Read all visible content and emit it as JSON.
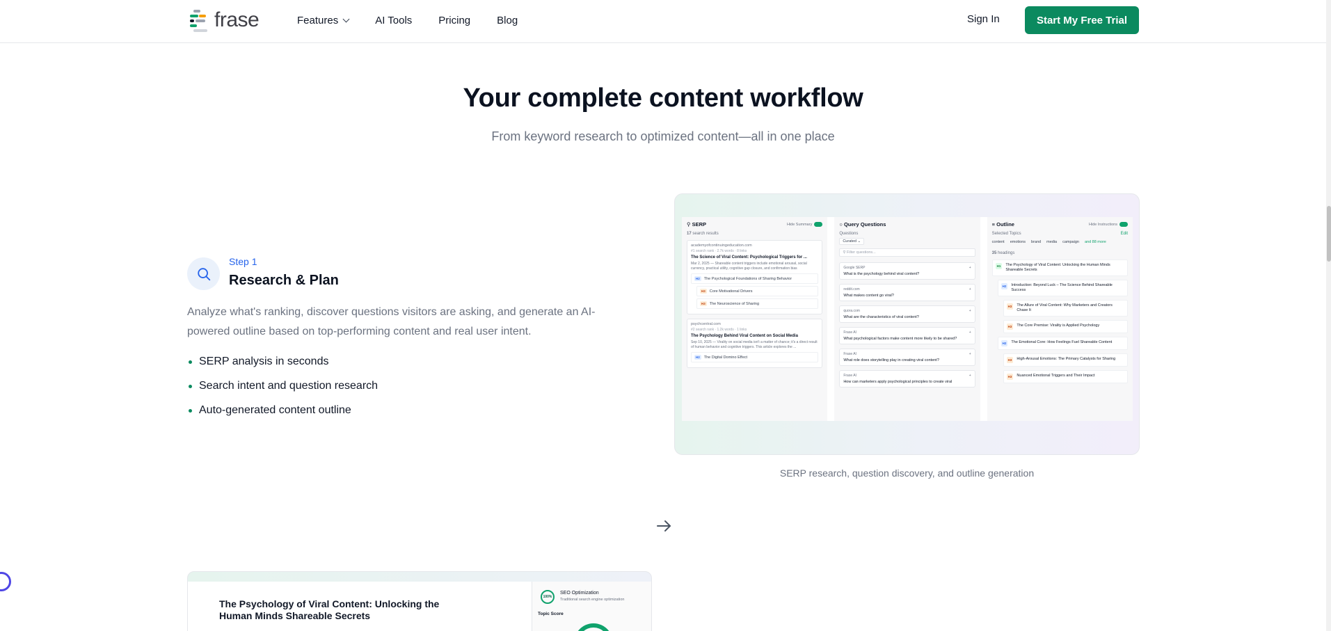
{
  "header": {
    "logo_text": "frase",
    "nav": [
      {
        "label": "Features",
        "has_dropdown": true
      },
      {
        "label": "AI Tools"
      },
      {
        "label": "Pricing"
      },
      {
        "label": "Blog"
      }
    ],
    "sign_in": "Sign In",
    "cta": "Start My Free Trial"
  },
  "hero": {
    "title": "Your complete content workflow",
    "subtitle": "From keyword research to optimized content—all in one place"
  },
  "step": {
    "label": "Step 1",
    "title": "Research & Plan",
    "description": "Analyze what's ranking, discover questions visitors are asking, and generate an AI-powered outline based on top-performing content and real user intent.",
    "bullets": [
      "SERP analysis in seconds",
      "Search intent and question research",
      "Auto-generated content outline"
    ],
    "icon": "search-icon"
  },
  "preview": {
    "serp": {
      "title": "SERP",
      "toggle_label": "Hide Summary",
      "count": "17",
      "count_label": "search results",
      "results": [
        {
          "source": "academyofcontinuingeducation.com",
          "meta": "#1 search rank · 2.7k words · 8 links",
          "title": "The Science of Viral Content: Psychological Triggers for ...",
          "snippet": "Mar 2, 2025 — Shareable content triggers include emotional arousal, social currency, practical utility, cognitive gap closure, and confirmation bias",
          "headings": [
            {
              "level": "H2",
              "text": "The Psychological Foundations of Sharing Behavior"
            },
            {
              "level": "H3",
              "text": "Core Motivational Drivers"
            },
            {
              "level": "H3",
              "text": "The Neuroscience of Sharing"
            }
          ]
        },
        {
          "source": "psychcentral.com",
          "meta": "#2 search rank · 1.2k words · 1 links",
          "title": "The Psychology Behind Viral Content on Social Media",
          "snippet": "Sep 10, 2025 — Virality on social media isn't a matter of chance; it's a direct result of human behavior and cognitive triggers. This article explores the ...",
          "headings": [
            {
              "level": "H2",
              "text": "The Digital Domino Effect"
            }
          ]
        }
      ]
    },
    "questions": {
      "title": "Query Questions",
      "section_label": "Questions",
      "filter_value": "Curated",
      "filter_placeholder": "Filter questions...",
      "items": [
        {
          "source": "Google SERP",
          "text": "What is the psychology behind viral content?"
        },
        {
          "source": "reddit.com",
          "text": "What makes content go viral?"
        },
        {
          "source": "quora.com",
          "text": "What are the characteristics of viral content?"
        },
        {
          "source": "Frase AI",
          "text": "What psychological factors make content more likely to be shared?"
        },
        {
          "source": "Frase AI",
          "text": "What role does storytelling play in creating viral content?"
        },
        {
          "source": "Frase AI",
          "text": "How can marketers apply psychological principles to create viral"
        }
      ]
    },
    "outline": {
      "title": "Outline",
      "toggle_label": "Hide Instructions",
      "topics_label": "Selected Topics",
      "edit_label": "Edit",
      "topics": [
        "content",
        "emotions",
        "brand",
        "media",
        "campaign"
      ],
      "more": "and 88 more",
      "count": "35",
      "count_label": "headings",
      "rows": [
        {
          "level": "H1",
          "text": "The Psychology of Viral Content: Unlocking the Human Minds Shareable Secrets"
        },
        {
          "level": "H2",
          "text": "Introduction: Beyond Luck – The Science Behind Shareable Success"
        },
        {
          "level": "H3",
          "text": "The Allure of Viral Content: Why Marketers and Creators Chase It"
        },
        {
          "level": "H3",
          "text": "The Core Premise: Virality is Applied Psychology"
        },
        {
          "level": "H2",
          "text": "The Emotional Core: How Feelings Fuel Shareable Content"
        },
        {
          "level": "H3",
          "text": "High-Arousal Emotions: The Primary Catalysts for Sharing"
        },
        {
          "level": "H3",
          "text": "Nuanced Emotional Triggers and Their Impact"
        }
      ]
    },
    "caption": "SERP research, question discovery, and outline generation"
  },
  "editor_preview": {
    "title": "The Psychology of Viral Content: Unlocking the Human Minds Shareable Secrets",
    "seo_score": "100%",
    "seo_title": "SEO Optimization",
    "seo_subtitle": "Traditional search engine optimization",
    "topic_score_label": "Topic Score"
  },
  "colors": {
    "brand_green": "#0b8a5f",
    "link_blue": "#2563eb"
  }
}
